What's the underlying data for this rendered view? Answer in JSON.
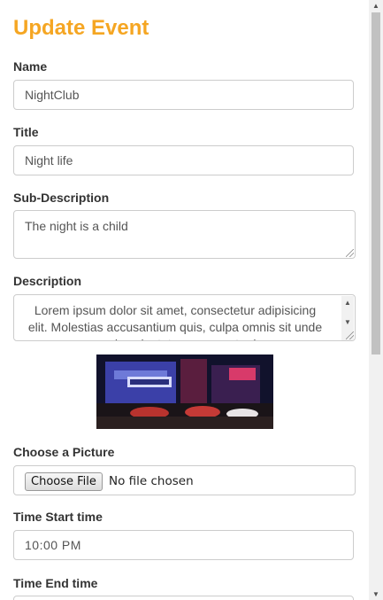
{
  "header": {
    "title": "Update Event"
  },
  "form": {
    "name_label": "Name",
    "name_value": "NightClub",
    "title_label": "Title",
    "title_value": "Night life",
    "subdesc_label": "Sub-Description",
    "subdesc_value": "The night is a child",
    "desc_label": "Description",
    "desc_value": "Lorem ipsum dolor sit amet, consectetur adipisicing elit. Molestias accusantium quis, culpa omnis sit unde assumenda voluptate consequatur ipsam.",
    "picture_label": "Choose a Picture",
    "file_button": "Choose File",
    "file_status": "No file chosen",
    "start_label": "Time Start time",
    "start_value": "10:00 PM",
    "end_label": "Time End time",
    "end_value": ""
  },
  "image": {
    "alt": "hotel at night"
  },
  "colors": {
    "accent": "#f5a623",
    "border": "#cccccc",
    "text": "#333333"
  }
}
